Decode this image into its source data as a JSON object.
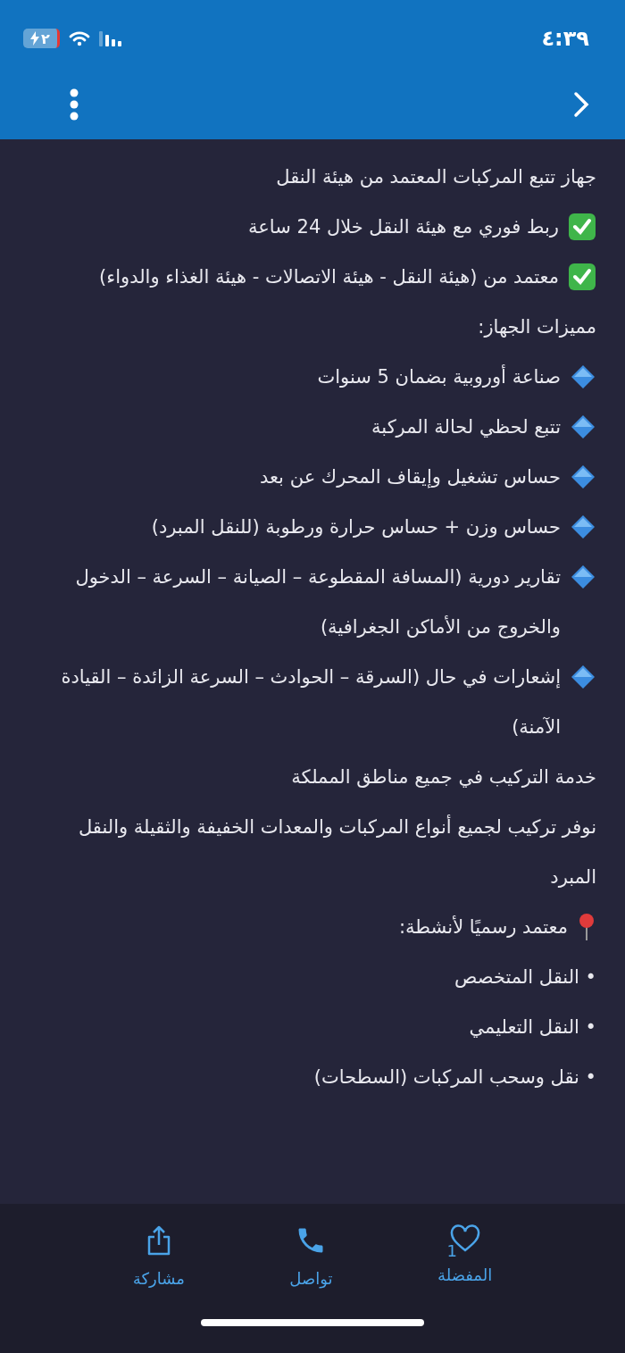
{
  "status_bar": {
    "time": "٤:٣٩",
    "battery": "٢"
  },
  "lines": [
    {
      "kind": "plain",
      "text": "جهاز تتبع المركبات المعتمد من هيئة النقل"
    },
    {
      "kind": "check",
      "text": "ربط فوري مع هيئة النقل خلال 24 ساعة"
    },
    {
      "kind": "check",
      "text": "معتمد من (هيئة النقل - هيئة الاتصالات - هيئة الغذاء والدواء)"
    },
    {
      "kind": "plain",
      "text": "مميزات الجهاز:"
    },
    {
      "kind": "diamond",
      "text": "صناعة أوروبية بضمان 5 سنوات"
    },
    {
      "kind": "diamond",
      "text": "تتبع لحظي لحالة المركبة"
    },
    {
      "kind": "diamond",
      "text": "حساس تشغيل وإيقاف المحرك عن بعد"
    },
    {
      "kind": "diamond",
      "text": "حساس وزن + حساس حرارة ورطوبة (للنقل المبرد)"
    },
    {
      "kind": "diamond",
      "text": "تقارير دورية (المسافة المقطوعة – الصيانة – السرعة – الدخول والخروج من الأماكن الجغرافية)"
    },
    {
      "kind": "diamond",
      "text": "إشعارات في حال (السرقة – الحوادث – السرعة الزائدة – القيادة الآمنة)"
    },
    {
      "kind": "plain",
      "text": "خدمة التركيب في جميع مناطق المملكة"
    },
    {
      "kind": "plain",
      "text": "نوفر تركيب لجميع أنواع المركبات والمعدات الخفيفة والثقيلة والنقل المبرد"
    },
    {
      "kind": "pin",
      "text": "معتمد رسميًا لأنشطة:"
    },
    {
      "kind": "bullet",
      "text": "• النقل المتخصص"
    },
    {
      "kind": "bullet",
      "text": "• النقل التعليمي"
    },
    {
      "kind": "bullet",
      "text": "• نقل وسحب المركبات (السطحات)"
    }
  ],
  "bottom_bar": [
    {
      "kind": "favorite",
      "label": "المفضلة",
      "count": "1"
    },
    {
      "kind": "contact",
      "label": "تواصل"
    },
    {
      "kind": "share",
      "label": "مشاركة"
    }
  ]
}
